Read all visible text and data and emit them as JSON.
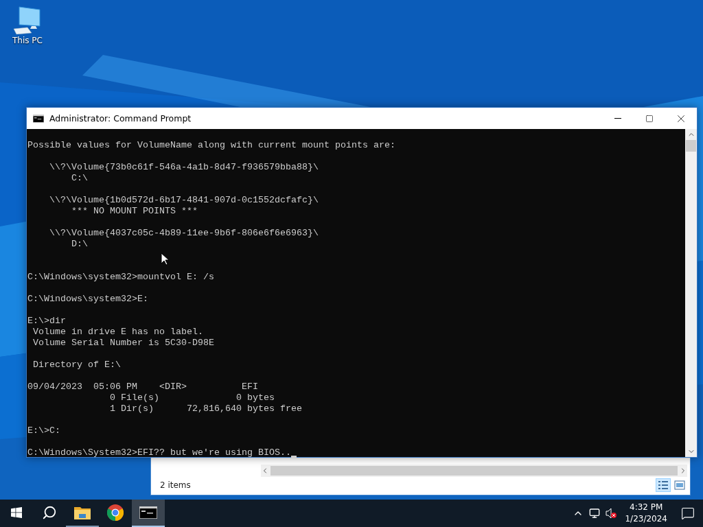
{
  "desktop": {
    "icons": [
      {
        "label": "This PC"
      }
    ]
  },
  "explorer_window": {
    "status": "2 items",
    "views": [
      {
        "kind": "details",
        "selected": true
      },
      {
        "kind": "preview",
        "selected": false
      }
    ]
  },
  "console_window": {
    "title": "Administrator: Command Prompt",
    "blocks": [
      {
        "kind": "output",
        "lines": [
          "Possible values for VolumeName along with current mount points are:"
        ]
      },
      {
        "kind": "listing",
        "lines": [
          "    \\\\?\\Volume{73b0c61f-546a-4a1b-8d47-f936579bba88}\\",
          "        C:\\"
        ]
      },
      {
        "kind": "listing",
        "lines": [
          "    \\\\?\\Volume{1b0d572d-6b17-4841-907d-0c1552dcfafc}\\",
          "        *** NO MOUNT POINTS ***"
        ]
      },
      {
        "kind": "listing",
        "lines": [
          "    \\\\?\\Volume{4037c05c-4b89-11ee-9b6f-806e6f6e6963}\\",
          "        D:\\"
        ]
      },
      {
        "kind": "prompt",
        "lines": [
          "C:\\Windows\\system32>mountvol E: /s"
        ]
      },
      {
        "kind": "prompt",
        "lines": [
          "C:\\Windows\\system32>E:"
        ]
      },
      {
        "kind": "prompt",
        "lines": [
          "E:\\>dir",
          " Volume in drive E has no label.",
          " Volume Serial Number is 5C30-D98E"
        ]
      },
      {
        "kind": "output",
        "lines": [
          " Directory of E:\\"
        ]
      },
      {
        "kind": "output",
        "lines": [
          "09/04/2023  05:06 PM    <DIR>          EFI",
          "               0 File(s)              0 bytes",
          "               1 Dir(s)      72,816,640 bytes free"
        ]
      },
      {
        "kind": "prompt",
        "lines": [
          "E:\\>C:"
        ]
      },
      {
        "kind": "prompt",
        "lines": [
          "C:\\Windows\\System32>EFI?? but we're using BIOS.."
        ]
      }
    ]
  },
  "taskbar": {
    "apps": [
      {
        "kind": "folder",
        "running": true,
        "selected": false
      },
      {
        "kind": "chrome",
        "running": false,
        "selected": false
      },
      {
        "kind": "terminal",
        "running": true,
        "selected": true
      }
    ],
    "clock": {
      "time": "4:32 PM",
      "date": "1/23/2024"
    }
  }
}
